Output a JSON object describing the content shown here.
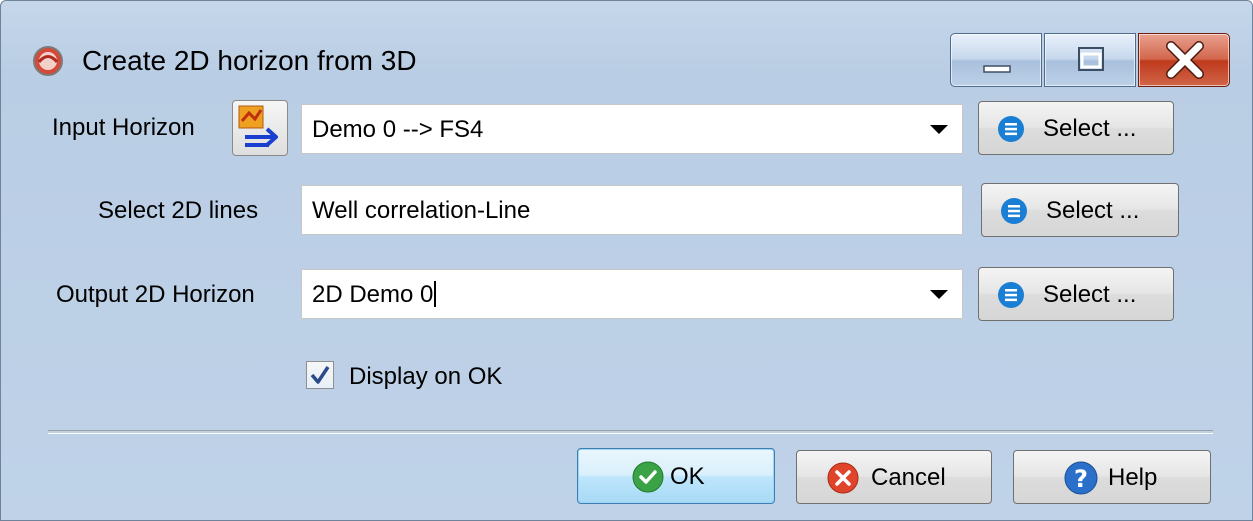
{
  "window": {
    "title": "Create 2D horizon from 3D"
  },
  "form": {
    "input_horizon": {
      "label": "Input Horizon",
      "value": "Demo 0 --> FS4",
      "select_label": "Select ..."
    },
    "select_2d_lines": {
      "label": "Select 2D lines",
      "value": "Well correlation-Line",
      "select_label": "Select ..."
    },
    "output_2d_horizon": {
      "label": "Output 2D Horizon",
      "value": "2D Demo 0",
      "select_label": "Select ..."
    },
    "display_on_ok": {
      "label": "Display on OK",
      "checked": true
    }
  },
  "footer": {
    "ok_label": "OK",
    "cancel_label": "Cancel",
    "help_label": "Help"
  },
  "colors": {
    "select_icon": "#1a7fd4",
    "ok_icon": "#3aa346",
    "cancel_icon": "#e0452c",
    "help_icon": "#2a6fc9"
  }
}
